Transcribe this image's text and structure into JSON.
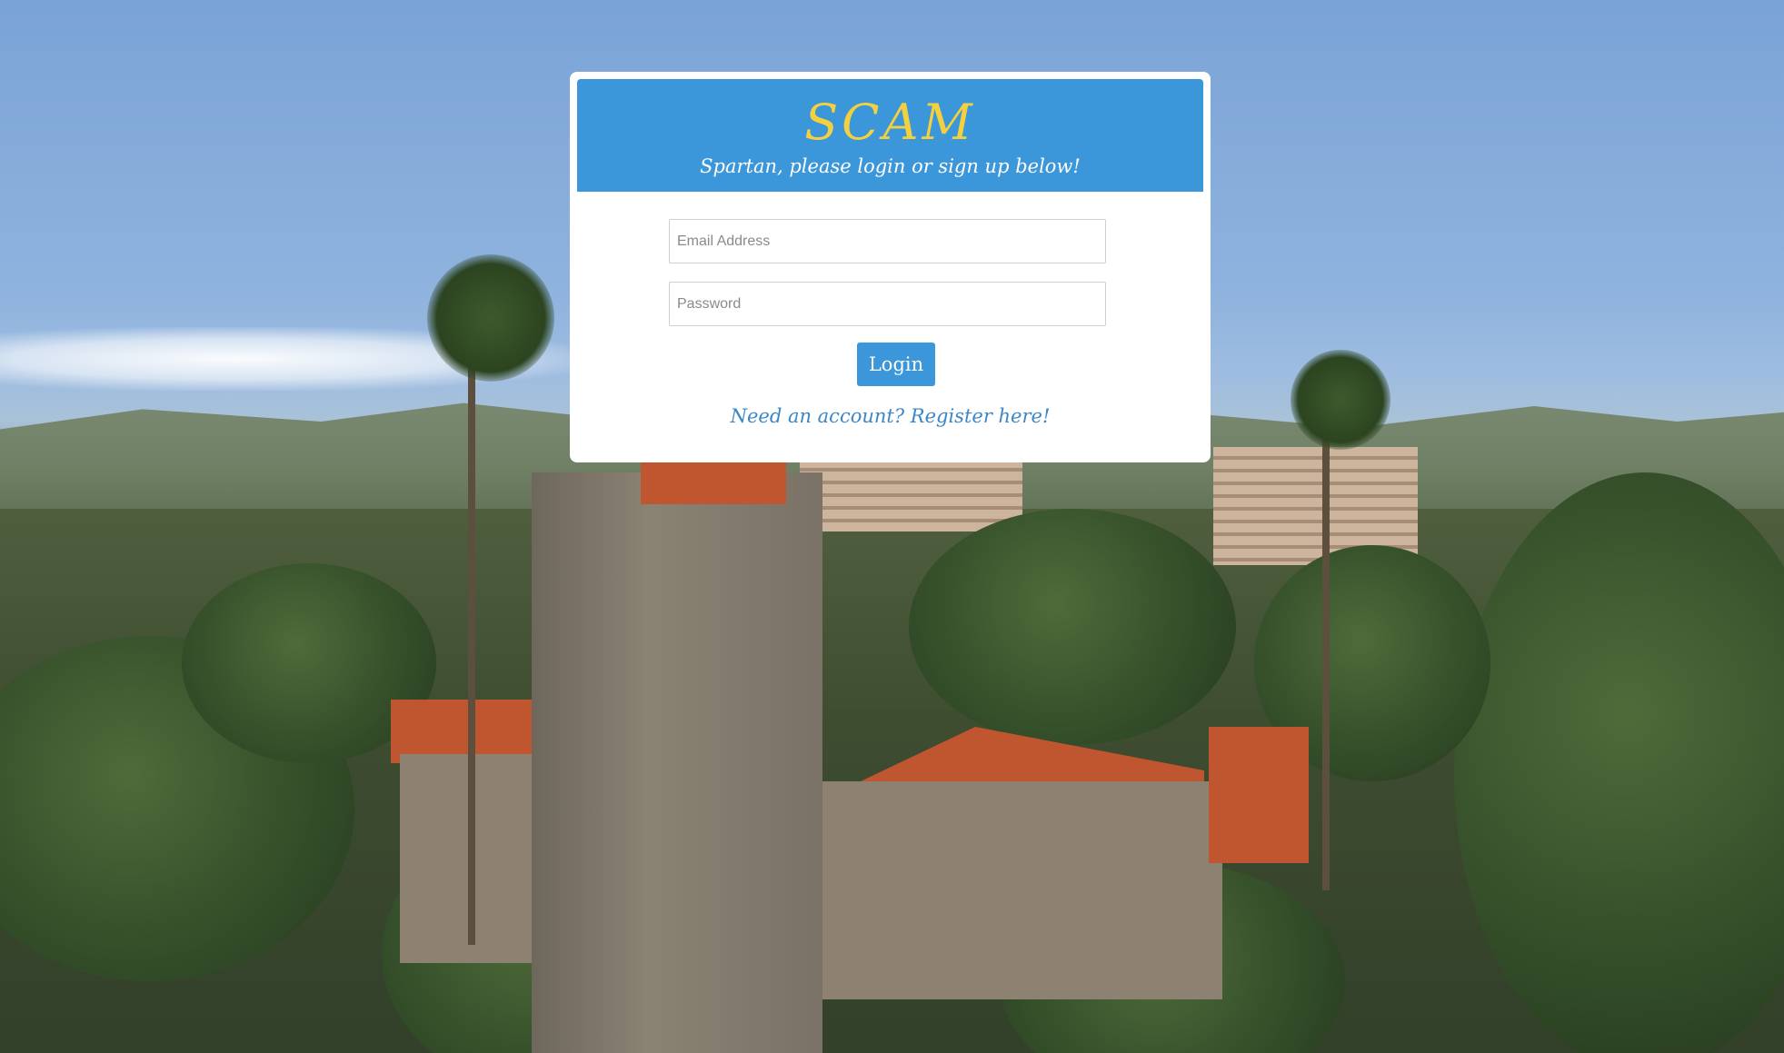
{
  "header": {
    "title": "SCAM",
    "subtitle": "Spartan, please login or sign up below!"
  },
  "form": {
    "email_placeholder": "Email Address",
    "email_value": "",
    "password_placeholder": "Password",
    "password_value": "",
    "login_label": "Login",
    "register_link": "Need an account? Register here!"
  },
  "colors": {
    "header_bg": "#3b97d9",
    "title": "#f4d03f",
    "button_bg": "#3b97d9",
    "link": "#3b87c6"
  },
  "background": {
    "description_icon": "campus-photo"
  }
}
